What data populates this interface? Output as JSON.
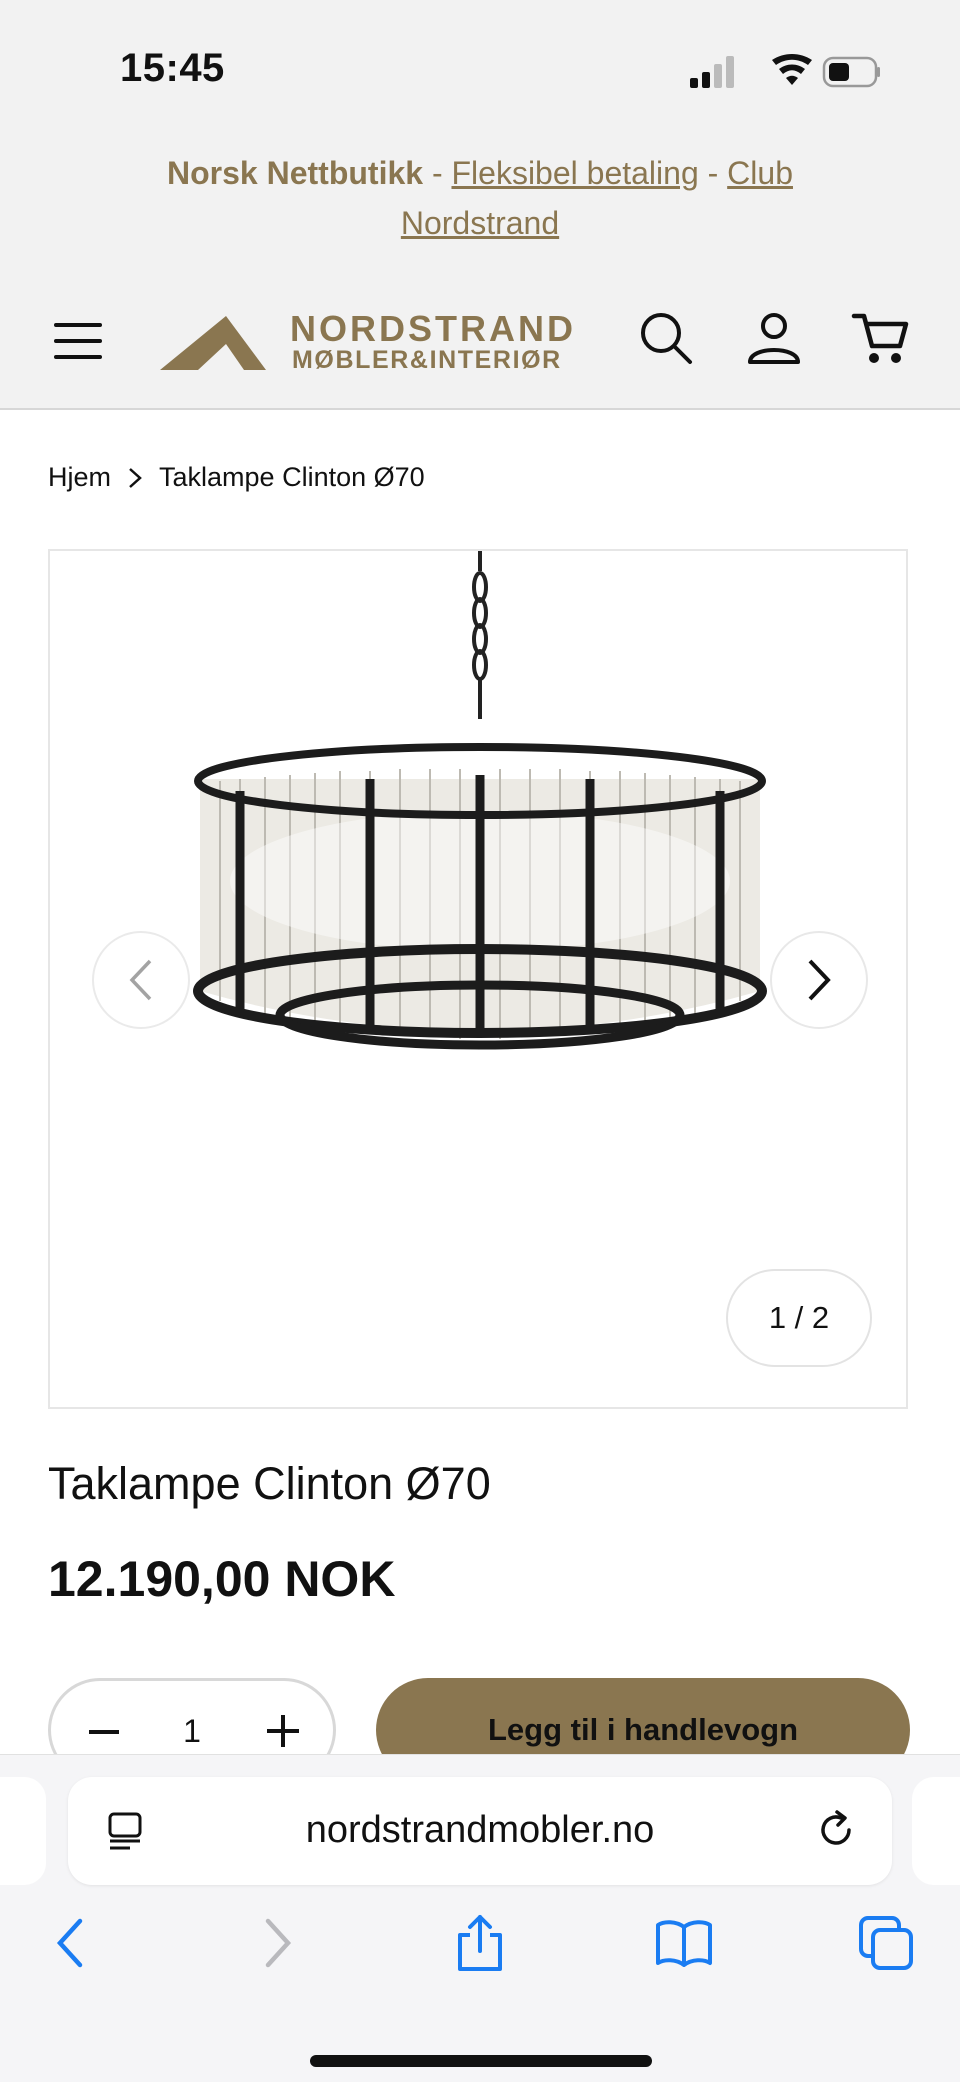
{
  "status": {
    "time": "15:45"
  },
  "announcement": {
    "brand": "Norsk Nettbutikk",
    "sep1": " - ",
    "link1": "Fleksibel betaling",
    "sep2": " - ",
    "link2_part1": "Club",
    "link2_part2": "Nordstrand"
  },
  "header": {
    "logo_line1": "NORDSTRAND",
    "logo_line2": "MØBLER&INTERIØR"
  },
  "breadcrumb": {
    "home": "Hjem",
    "current": "Taklampe Clinton Ø70"
  },
  "gallery": {
    "counter": "1 / 2"
  },
  "product": {
    "title": "Taklampe Clinton Ø70",
    "price": "12.190,00 NOK",
    "quantity": "1",
    "add_to_cart": "Legg til i handlevogn"
  },
  "browser": {
    "url": "nordstrandmobler.no"
  },
  "colors": {
    "brand_gold": "#8a7650",
    "link_blue": "#1a7cf2"
  },
  "icons": [
    "signal-icon",
    "wifi-icon",
    "battery-icon",
    "menu-icon",
    "search-icon",
    "user-icon",
    "cart-icon",
    "chevron-left-icon",
    "chevron-right-icon",
    "reader-icon",
    "reload-icon",
    "back-icon",
    "forward-icon",
    "share-icon",
    "bookmarks-icon",
    "tabs-icon"
  ]
}
